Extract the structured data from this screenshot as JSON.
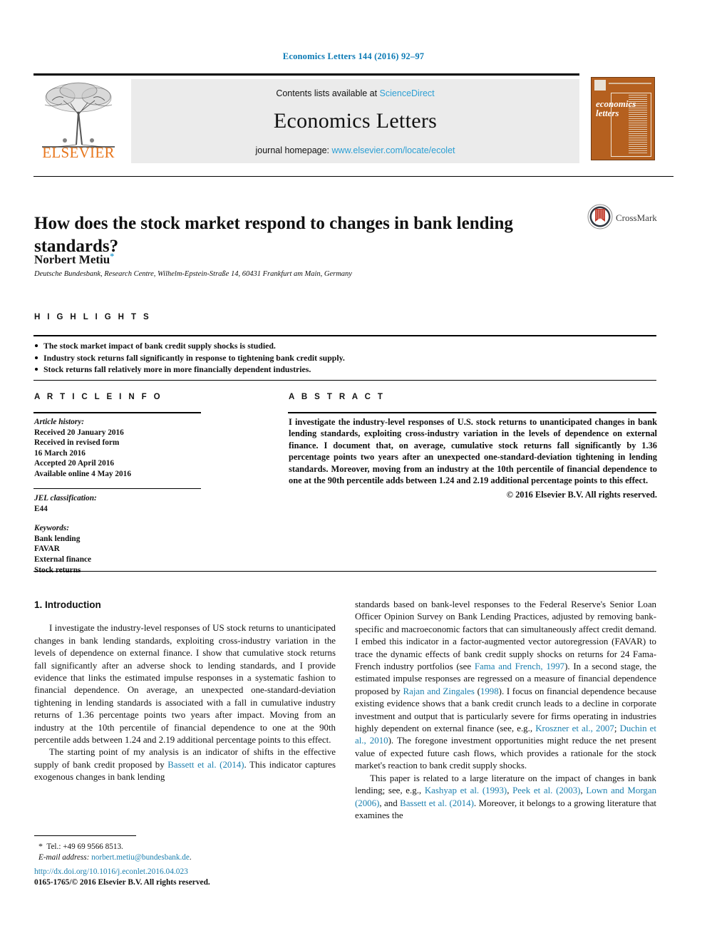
{
  "journal_ref": "Economics Letters 144 (2016) 92–97",
  "masthead": {
    "contents_prefix": "Contents lists available at ",
    "sciencedirect": "ScienceDirect",
    "journal_title": "Economics Letters",
    "homepage_prefix": "journal homepage: ",
    "homepage_url": "www.elsevier.com/locate/ecolet",
    "publisher": "ELSEVIER",
    "cover_title_line1": "economics",
    "cover_title_line2": "letters"
  },
  "article": {
    "title": "How does the stock market respond to changes in bank lending standards?",
    "author": "Norbert Metiu",
    "author_mark": "*",
    "affiliation": "Deutsche Bundesbank, Research Centre, Wilhelm-Epstein-Straße 14, 60431 Frankfurt am Main, Germany",
    "crossmark_label": "CrossMark"
  },
  "highlights": {
    "heading": "H I G H L I G H T S",
    "items": [
      "The stock market impact of bank credit supply shocks is studied.",
      "Industry stock returns fall significantly in response to tightening bank credit supply.",
      "Stock returns fall relatively more in more financially dependent industries."
    ]
  },
  "article_info": {
    "heading": "A R T I C L E   I N F O",
    "history_label": "Article history:",
    "history": [
      "Received 20 January 2016",
      "Received in revised form",
      "16 March 2016",
      "Accepted 20 April 2016",
      "Available online 4 May 2016"
    ],
    "jel_label": "JEL classification:",
    "jel_codes": "E44",
    "keywords_label": "Keywords:",
    "keywords": [
      "Bank lending",
      "FAVAR",
      "External finance",
      "Stock returns"
    ]
  },
  "abstract": {
    "heading": "A B S T R A C T",
    "text": "I investigate the industry-level responses of U.S. stock returns to unanticipated changes in bank lending standards, exploiting cross-industry variation in the levels of dependence on external finance. I document that, on average, cumulative stock returns fall significantly by 1.36 percentage points two years after an unexpected one-standard-deviation tightening in lending standards. Moreover, moving from an industry at the 10th percentile of financial dependence to one at the 90th percentile adds between 1.24 and 2.19 additional percentage points to this effect.",
    "copyright": "© 2016 Elsevier B.V. All rights reserved."
  },
  "body": {
    "section_heading": "1. Introduction",
    "left_p1": "I investigate the industry-level responses of US stock returns to unanticipated changes in bank lending standards, exploiting cross-industry variation in the levels of dependence on external finance. I show that cumulative stock returns fall significantly after an adverse shock to lending standards, and I provide evidence that links the estimated impulse responses in a systematic fashion to financial dependence. On average, an unexpected one-standard-deviation tightening in lending standards is associated with a fall in cumulative industry returns of 1.36 percentage points two years after impact. Moving from an industry at the 10th percentile of financial dependence to one at the 90th percentile adds between 1.24 and 2.19 additional percentage points to this effect.",
    "left_p2_a": "The starting point of my analysis is an indicator of shifts in the effective supply of bank credit proposed by ",
    "left_p2_cite": "Bassett et al. (2014)",
    "left_p2_b": ". This indicator captures exogenous changes in bank lending",
    "right_p1_a": "standards based on bank-level responses to the Federal Reserve's Senior Loan Officer Opinion Survey on Bank Lending Practices, adjusted by removing bank-specific and macroeconomic factors that can simultaneously affect credit demand. I embed this indicator in a factor-augmented vector autoregression (FAVAR) to trace the dynamic effects of bank credit supply shocks on returns for 24 Fama-French industry portfolios (see ",
    "right_p1_cite1": "Fama and French, 1997",
    "right_p1_b": "). In a second stage, the estimated impulse responses are regressed on a measure of financial dependence proposed by ",
    "right_p1_cite2": "Rajan and Zingales",
    "right_p1_c": " (",
    "right_p1_cite3": "1998",
    "right_p1_d": "). I focus on financial dependence because existing evidence shows that a bank credit crunch leads to a decline in corporate investment and output that is particularly severe for firms operating in industries highly dependent on external finance (see, e.g., ",
    "right_p1_cite4": "Kroszner et al., 2007",
    "right_p1_e": "; ",
    "right_p1_cite5": "Duchin et al., 2010",
    "right_p1_f": "). The foregone investment opportunities might reduce the net present value of expected future cash flows, which provides a rationale for the stock market's reaction to bank credit supply shocks.",
    "right_p2_a": "This paper is related to a large literature on the impact of changes in bank lending; see, e.g., ",
    "right_p2_cite1": "Kashyap et al. (1993)",
    "right_p2_b": ", ",
    "right_p2_cite2": "Peek et al. (2003)",
    "right_p2_c": ", ",
    "right_p2_cite3": "Lown and Morgan (2006)",
    "right_p2_d": ", and ",
    "right_p2_cite4": "Bassett et al. (2014)",
    "right_p2_e": ". Moreover, it belongs to a growing literature that examines the"
  },
  "footer": {
    "tel_mark": "*",
    "tel": "Tel.: +49 69 9566 8513.",
    "email_label": "E-mail address:",
    "email": "norbert.metiu@bundesbank.de",
    "email_suffix": ".",
    "doi": "http://dx.doi.org/10.1016/j.econlet.2016.04.023",
    "issn": "0165-1765/© 2016 Elsevier B.V. All rights reserved."
  },
  "colors": {
    "link_blue": "#1a7fae",
    "header_blue": "#0b7ab5",
    "elsevier_orange": "#e8761c",
    "cover_orange": "#b5601f"
  }
}
